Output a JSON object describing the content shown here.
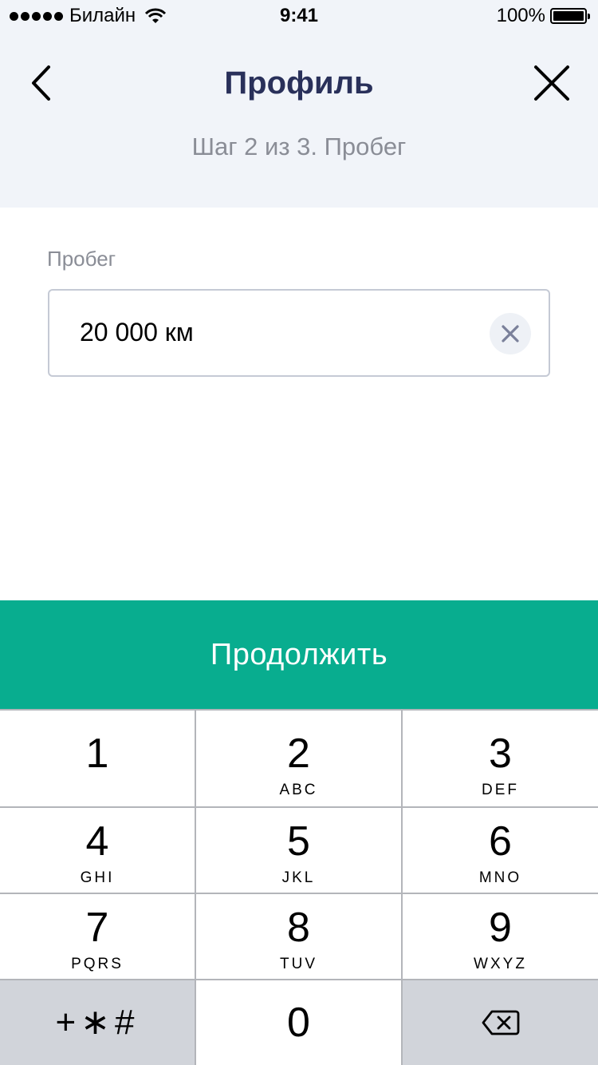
{
  "status_bar": {
    "carrier": "Билайн",
    "time": "9:41",
    "battery_percent": "100%",
    "signal_bars": 5
  },
  "header": {
    "back_icon": "chevron-left-icon",
    "title": "Профиль",
    "subtitle": "Шаг 2 из 3. Пробег",
    "close_icon": "close-icon"
  },
  "form": {
    "label": "Пробег",
    "value": "20 000 км",
    "clear_icon": "clear-x-icon"
  },
  "continue_button": {
    "label": "Продолжить",
    "color": "#08ad8f"
  },
  "keypad": {
    "keys": [
      {
        "digit": "1",
        "letters": ""
      },
      {
        "digit": "2",
        "letters": "ABC"
      },
      {
        "digit": "3",
        "letters": "DEF"
      },
      {
        "digit": "4",
        "letters": "GHI"
      },
      {
        "digit": "5",
        "letters": "JKL"
      },
      {
        "digit": "6",
        "letters": "MNO"
      },
      {
        "digit": "7",
        "letters": "PQRS"
      },
      {
        "digit": "8",
        "letters": "TUV"
      },
      {
        "digit": "9",
        "letters": "WXYZ"
      }
    ],
    "symbols": "+∗#",
    "zero": "0",
    "delete_icon": "backspace-icon"
  },
  "colors": {
    "header_bg": "#f1f4f9",
    "title": "#29305a",
    "muted_text": "#8a8d96",
    "accent": "#08ad8f"
  }
}
